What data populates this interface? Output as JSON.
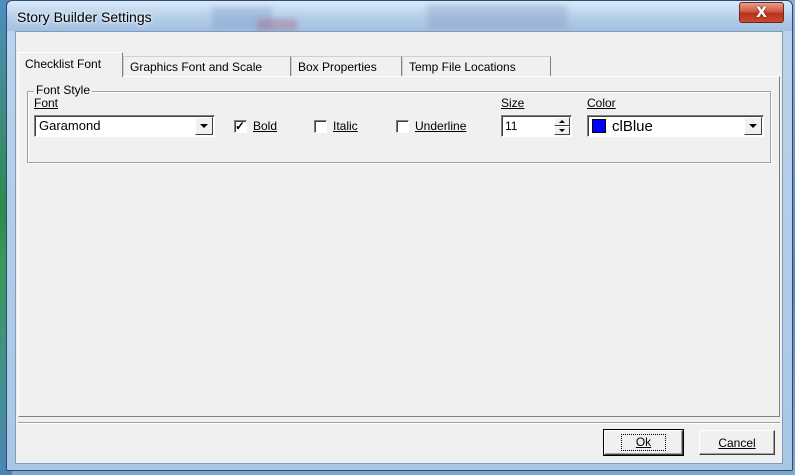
{
  "window": {
    "title": "Story Builder Settings",
    "close_glyph": "X"
  },
  "tabs": [
    {
      "label": "Checklist Font",
      "active": true
    },
    {
      "label": "Graphics Font and Scale",
      "active": false
    },
    {
      "label": "Box Properties",
      "active": false
    },
    {
      "label": "Temp File Locations",
      "active": false
    }
  ],
  "font_style": {
    "group_label": "Font Style",
    "font_label": "Font",
    "font_value": "Garamond",
    "bold_label": "Bold",
    "bold_checked": true,
    "italic_label": "Italic",
    "italic_checked": false,
    "underline_label": "Underline",
    "underline_checked": false,
    "size_label": "Size",
    "size_value": "11",
    "color_label": "Color",
    "color_value": "clBlue",
    "color_swatch": "#0000ff",
    "check_mark": "✓"
  },
  "buttons": {
    "ok": "Ok",
    "cancel": "Cancel"
  }
}
